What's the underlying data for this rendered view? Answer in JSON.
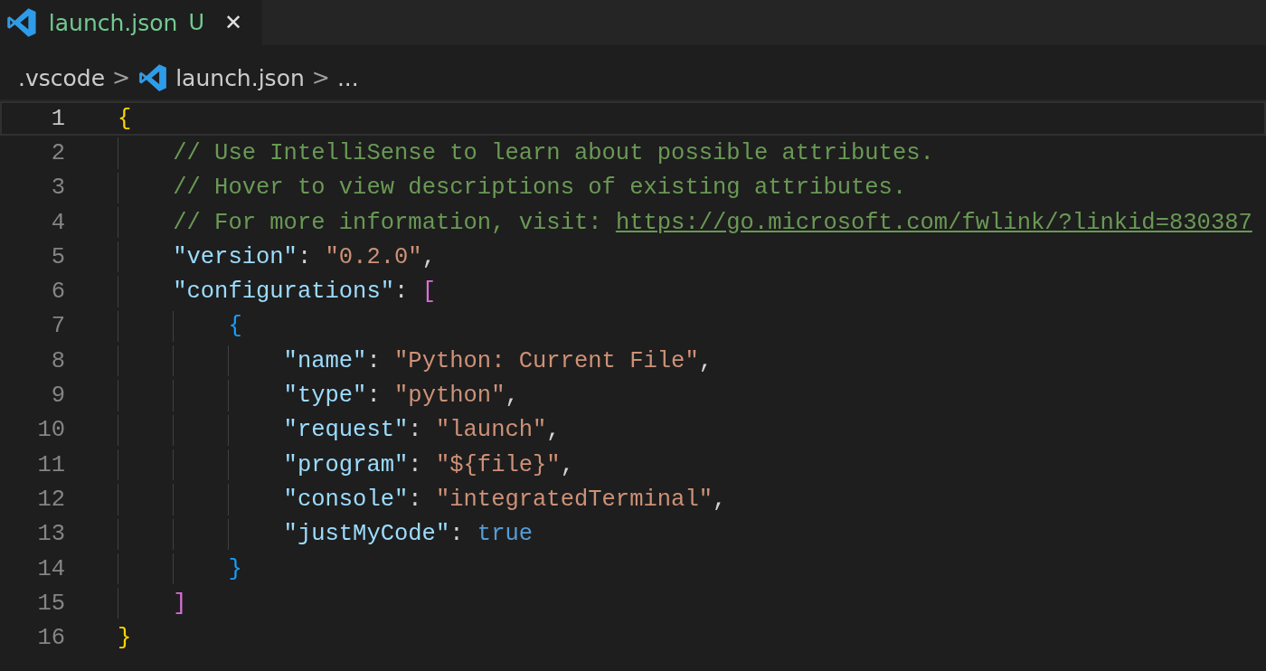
{
  "tabs": [
    {
      "label": "launch.json",
      "badge": "U",
      "close": "✕",
      "selected": true
    }
  ],
  "breadcrumb": {
    "items": [
      {
        "kind": "folder",
        "label": ".vscode"
      },
      {
        "kind": "file",
        "label": "launch.json"
      },
      {
        "kind": "more",
        "label": "..."
      }
    ],
    "separator": ">"
  },
  "editor": {
    "lines": [
      {
        "number": "1",
        "active": true,
        "tokens": [
          {
            "kind": "brace1",
            "text": "{"
          }
        ]
      },
      {
        "number": "2",
        "active": false,
        "tokens": [
          {
            "kind": "comment",
            "text": "    // Use IntelliSense to learn about possible attributes."
          }
        ]
      },
      {
        "number": "3",
        "active": false,
        "tokens": [
          {
            "kind": "comment",
            "text": "    // Hover to view descriptions of existing attributes."
          }
        ]
      },
      {
        "number": "4",
        "active": false,
        "tokens": [
          {
            "kind": "comment",
            "text": "    // For more information, visit: "
          },
          {
            "kind": "link",
            "text": "https://go.microsoft.com/fwlink/?linkid=830387"
          }
        ]
      },
      {
        "number": "5",
        "active": false,
        "tokens": [
          {
            "kind": "key",
            "text": "    \"version\""
          },
          {
            "kind": "punct",
            "text": ": "
          },
          {
            "kind": "string",
            "text": "\"0.2.0\""
          },
          {
            "kind": "punct",
            "text": ","
          }
        ]
      },
      {
        "number": "6",
        "active": false,
        "tokens": [
          {
            "kind": "key",
            "text": "    \"configurations\""
          },
          {
            "kind": "punct",
            "text": ": "
          },
          {
            "kind": "brace2",
            "text": "["
          }
        ]
      },
      {
        "number": "7",
        "active": false,
        "tokens": [
          {
            "kind": "brace3",
            "text": "        {"
          }
        ]
      },
      {
        "number": "8",
        "active": false,
        "tokens": [
          {
            "kind": "key",
            "text": "            \"name\""
          },
          {
            "kind": "punct",
            "text": ": "
          },
          {
            "kind": "string",
            "text": "\"Python: Current File\""
          },
          {
            "kind": "punct",
            "text": ","
          }
        ]
      },
      {
        "number": "9",
        "active": false,
        "tokens": [
          {
            "kind": "key",
            "text": "            \"type\""
          },
          {
            "kind": "punct",
            "text": ": "
          },
          {
            "kind": "string",
            "text": "\"python\""
          },
          {
            "kind": "punct",
            "text": ","
          }
        ]
      },
      {
        "number": "10",
        "active": false,
        "tokens": [
          {
            "kind": "key",
            "text": "            \"request\""
          },
          {
            "kind": "punct",
            "text": ": "
          },
          {
            "kind": "string",
            "text": "\"launch\""
          },
          {
            "kind": "punct",
            "text": ","
          }
        ]
      },
      {
        "number": "11",
        "active": false,
        "tokens": [
          {
            "kind": "key",
            "text": "            \"program\""
          },
          {
            "kind": "punct",
            "text": ": "
          },
          {
            "kind": "string",
            "text": "\"${file}\""
          },
          {
            "kind": "punct",
            "text": ","
          }
        ]
      },
      {
        "number": "12",
        "active": false,
        "tokens": [
          {
            "kind": "key",
            "text": "            \"console\""
          },
          {
            "kind": "punct",
            "text": ": "
          },
          {
            "kind": "string",
            "text": "\"integratedTerminal\""
          },
          {
            "kind": "punct",
            "text": ","
          }
        ]
      },
      {
        "number": "13",
        "active": false,
        "tokens": [
          {
            "kind": "key",
            "text": "            \"justMyCode\""
          },
          {
            "kind": "punct",
            "text": ": "
          },
          {
            "kind": "bool",
            "text": "true"
          }
        ]
      },
      {
        "number": "14",
        "active": false,
        "tokens": [
          {
            "kind": "brace3",
            "text": "        }"
          }
        ]
      },
      {
        "number": "15",
        "active": false,
        "tokens": [
          {
            "kind": "brace2",
            "text": "    ]"
          }
        ]
      },
      {
        "number": "16",
        "active": false,
        "tokens": [
          {
            "kind": "brace1",
            "text": "}"
          }
        ]
      }
    ]
  }
}
